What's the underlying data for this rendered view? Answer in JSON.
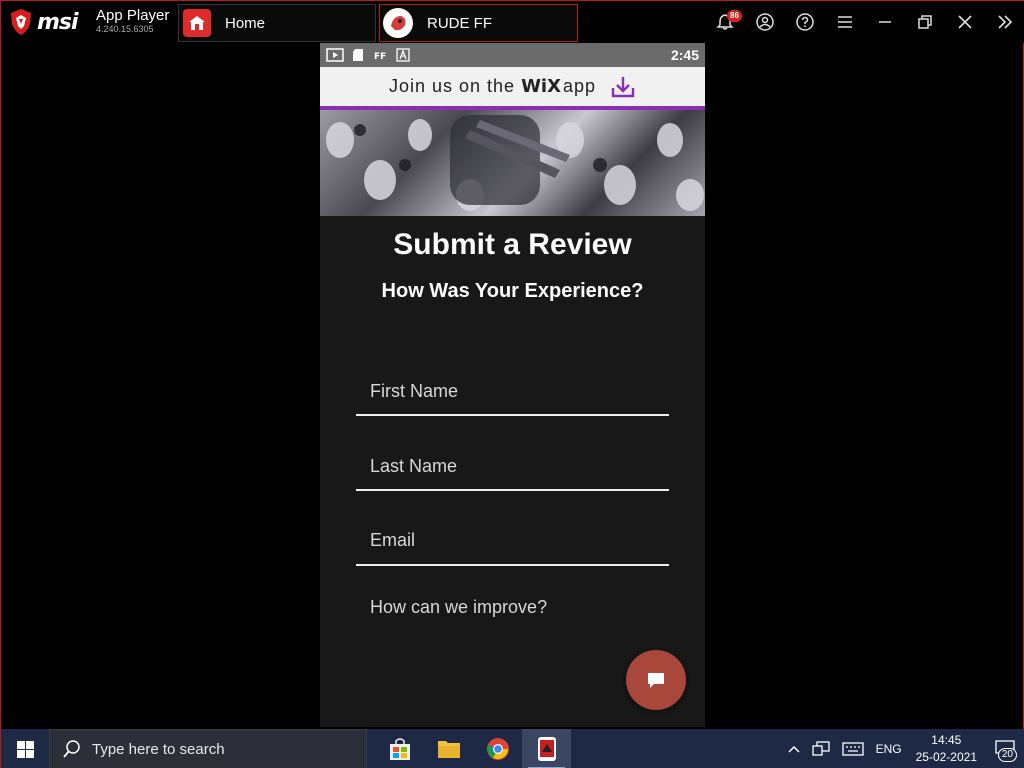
{
  "titlebar": {
    "app_name": "App Player",
    "version": "4.240.15.6305",
    "notification_count": "86",
    "tabs": [
      {
        "label": "Home"
      },
      {
        "label": "RUDE FF"
      }
    ]
  },
  "phone": {
    "status_time": "2:45",
    "wix_banner": {
      "prefix": "Join us on the",
      "logo": "WiX",
      "suffix": "app"
    },
    "title": "Submit a Review",
    "subtitle": "How Was Your Experience?",
    "fields": {
      "first_name": "First Name",
      "last_name": "Last Name",
      "email": "Email",
      "improve": "How can we improve?"
    }
  },
  "taskbar": {
    "search_placeholder": "Type here to search",
    "language": "ENG",
    "time": "14:45",
    "date": "25-02-2021",
    "notification_count": "20"
  },
  "colors": {
    "accent_red": "#b51c1c",
    "wix_purple": "#8a2fb3",
    "chat_button": "#a9473a",
    "taskbar": "#1e2a45"
  }
}
